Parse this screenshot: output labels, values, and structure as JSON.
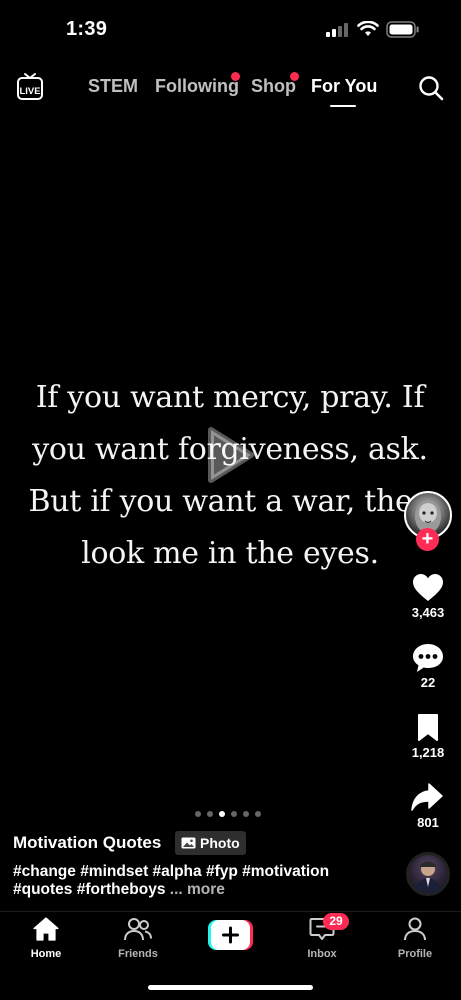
{
  "status_bar": {
    "time": "1:39"
  },
  "top_nav": {
    "live_label": "LIVE",
    "tabs": [
      {
        "label": "STEM"
      },
      {
        "label": "Following"
      },
      {
        "label": "Shop"
      },
      {
        "label": "For You"
      }
    ],
    "active_tab": "For You"
  },
  "post": {
    "quote_lines": [
      "If you want mercy, pray. If",
      "you want forgiveness, ask.",
      "But if you want a war, then",
      "look me in the eyes."
    ],
    "likes": "3,463",
    "comments": "22",
    "bookmarks": "1,218",
    "shares": "801",
    "author": "Motivation Quotes",
    "type_badge": "Photo",
    "caption_line1": "#change #mindset #alpha #fyp #motivation",
    "caption_line2": "#quotes #fortheboys",
    "more_label": "... more",
    "pagination": {
      "total": 6,
      "active_index": 2
    }
  },
  "bottom_nav": {
    "items": [
      {
        "label": "Home"
      },
      {
        "label": "Friends"
      },
      {
        "label": "Inbox"
      },
      {
        "label": "Profile"
      }
    ],
    "inbox_badge": "29"
  },
  "colors": {
    "accent": "#fe2c55",
    "background": "#000000",
    "create_cyan": "#25f4ee"
  }
}
